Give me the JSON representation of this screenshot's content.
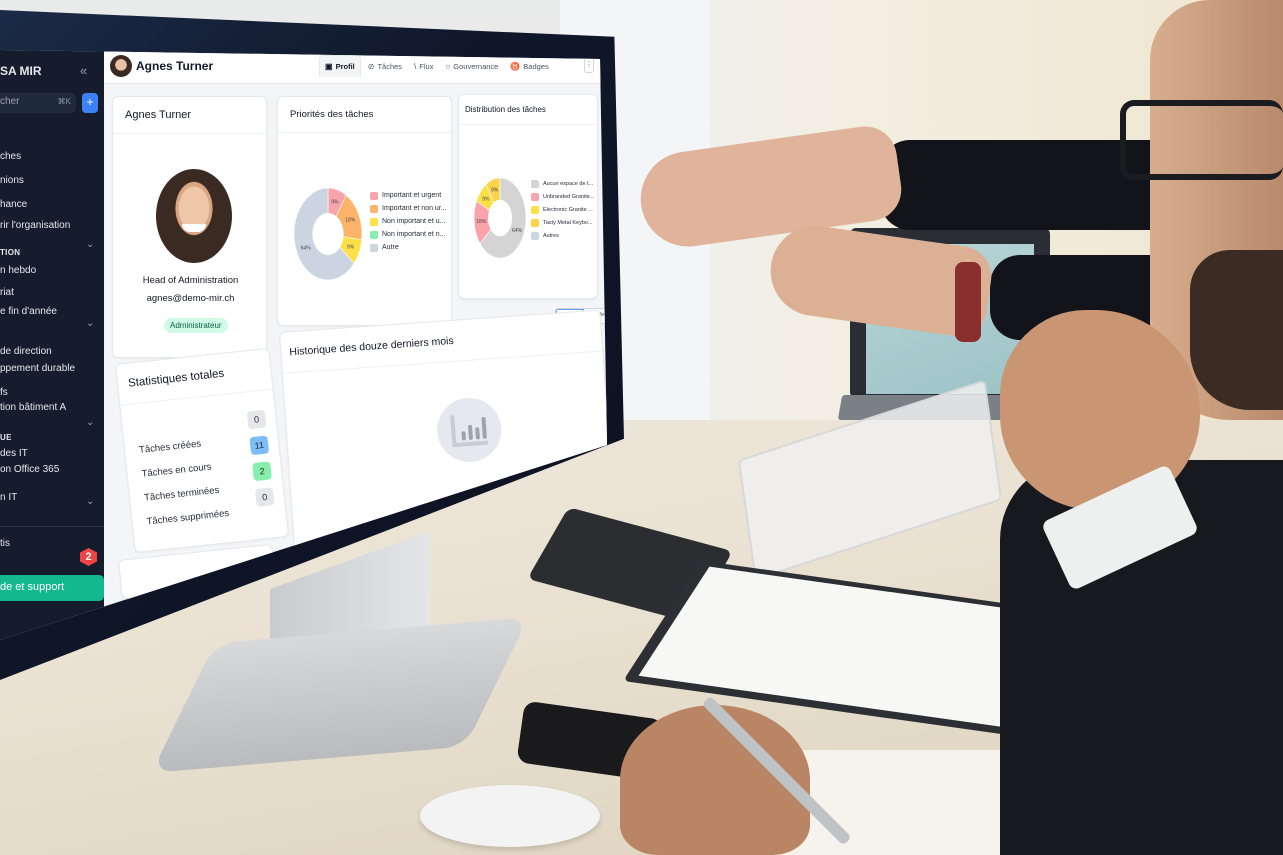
{
  "sidebar": {
    "brand": "SA MIR",
    "collapse_icon": "double-chevron-left-icon",
    "search_placeholder": "cher",
    "search_shortcut": "⌘K",
    "add_label": "+",
    "items": [
      {
        "label": "ches"
      },
      {
        "label": "nions"
      },
      {
        "label": "hance"
      },
      {
        "label": "rir l'organisation"
      }
    ],
    "sections": [
      {
        "title": "TION",
        "items": [
          {
            "label": "n hebdo"
          },
          {
            "label": "riat"
          },
          {
            "label": "e fin d'année"
          }
        ]
      },
      {
        "title": "",
        "items": [
          {
            "label": "de direction"
          },
          {
            "label": "ppement durable"
          },
          {
            "label": "fs"
          },
          {
            "label": "tion bâtiment A"
          }
        ]
      },
      {
        "title": "UE",
        "items": [
          {
            "label": "des IT"
          },
          {
            "label": "on Office 365"
          },
          {
            "label": "n IT"
          }
        ]
      }
    ],
    "footer_item": "tis",
    "notification_count": "2",
    "help_label": "de et support"
  },
  "header": {
    "user_name": "Agnes Turner",
    "tabs": [
      {
        "label": "Profil",
        "icon": "id-card-icon",
        "active": true
      },
      {
        "label": "Tâches",
        "icon": "check-circle-icon",
        "active": false
      },
      {
        "label": "Flux",
        "icon": "rss-icon",
        "active": false
      },
      {
        "label": "Gouvernance",
        "icon": "governance-icon",
        "active": false
      },
      {
        "label": "Badges",
        "icon": "medal-icon",
        "active": false
      }
    ],
    "more_icon": "⋮"
  },
  "profile": {
    "card_title": "Agnes Turner",
    "job_title": "Head of Administration",
    "email": "agnes@demo-mir.ch",
    "role_badge": "Administrateur"
  },
  "stats": {
    "title": "Statistiques totales",
    "rows": [
      {
        "label": "Tâches créées",
        "value": "0"
      },
      {
        "label": "Tâches en cours",
        "value": "11"
      },
      {
        "label": "Tâches terminées",
        "value": "2"
      },
      {
        "label": "Tâches supprimées",
        "value": "0"
      }
    ]
  },
  "history": {
    "title": "Historique des douze derniers mois",
    "group_label": "Grouper",
    "stack_label": "Empiler",
    "empty_icon": "bar-chart-icon"
  },
  "chart_data": [
    {
      "type": "pie",
      "title": "Priorités des tâches",
      "categories": [
        "Important et urgent",
        "Important et non ur...",
        "Non important et u...",
        "Non important et n...",
        "Autre"
      ],
      "values": [
        9,
        18,
        9,
        0,
        64
      ],
      "labels": [
        "9%",
        "18%",
        "9%",
        "",
        "64%"
      ],
      "colors": [
        "#f9a3ab",
        "#fbb469",
        "#fde047",
        "#86efac",
        "#cbd5e1"
      ],
      "legend": "right"
    },
    {
      "type": "pie",
      "title": "Distribution des tâches",
      "categories": [
        "Aucun espace de t...",
        "Unbranded Granite...",
        "Electronic Granite ...",
        "Tasty Metal Keybo...",
        "Autres"
      ],
      "values": [
        64,
        18,
        9,
        9,
        0
      ],
      "labels": [
        "64%",
        "18%",
        "9%",
        "9%",
        ""
      ],
      "colors": [
        "#d4d4d4",
        "#f9a3ab",
        "#fde047",
        "#fcd34d",
        "#cbd5e1"
      ],
      "legend": "right"
    }
  ]
}
